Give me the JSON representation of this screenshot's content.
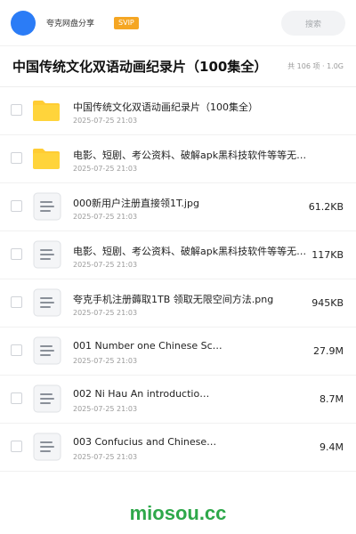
{
  "header": {
    "share_title": "夸克网盘分享",
    "badge": "SVIP",
    "search_label": "搜索",
    "accent_color": "#2b7cf6",
    "badge_color": "#f5a623"
  },
  "folder": {
    "title": "中国传统文化双语动画纪录片（100集全）",
    "meta": "共 106 项 · 1.0G"
  },
  "files": [
    {
      "icon": "folder-icon",
      "name": "中国传统文化双语动画纪录片（100集全）",
      "date": "2025-07-25 21:03",
      "size": ""
    },
    {
      "icon": "folder-icon",
      "name": "电影、短剧、考公资料、破解apk黑科技软件等等无偿…",
      "date": "2025-07-25 21:03",
      "size": ""
    },
    {
      "icon": "document-icon",
      "name": "000新用户注册直接领1T.jpg",
      "date": "2025-07-25 21:03",
      "size": "61.2KB"
    },
    {
      "icon": "document-icon",
      "name": "电影、短剧、考公资料、破解apk黑科技软件等等无偿…",
      "date": "2025-07-25 21:03",
      "size": "117KB"
    },
    {
      "icon": "document-icon",
      "name": "夸克手机注册薅取1TB 领取无限空间方法.png",
      "date": "2025-07-25 21:03",
      "size": "945KB"
    },
    {
      "icon": "document-icon",
      "name": "001 Number one Chinese Sc…",
      "date": "2025-07-25 21:03",
      "size": "27.9M"
    },
    {
      "icon": "document-icon",
      "name": "002 Ni Hau An introductio…",
      "date": "2025-07-25 21:03",
      "size": "8.7M"
    },
    {
      "icon": "document-icon",
      "name": "003 Confucius and Chinese…",
      "date": "2025-07-25 21:03",
      "size": "9.4M"
    }
  ],
  "watermark": "miosou.cc"
}
